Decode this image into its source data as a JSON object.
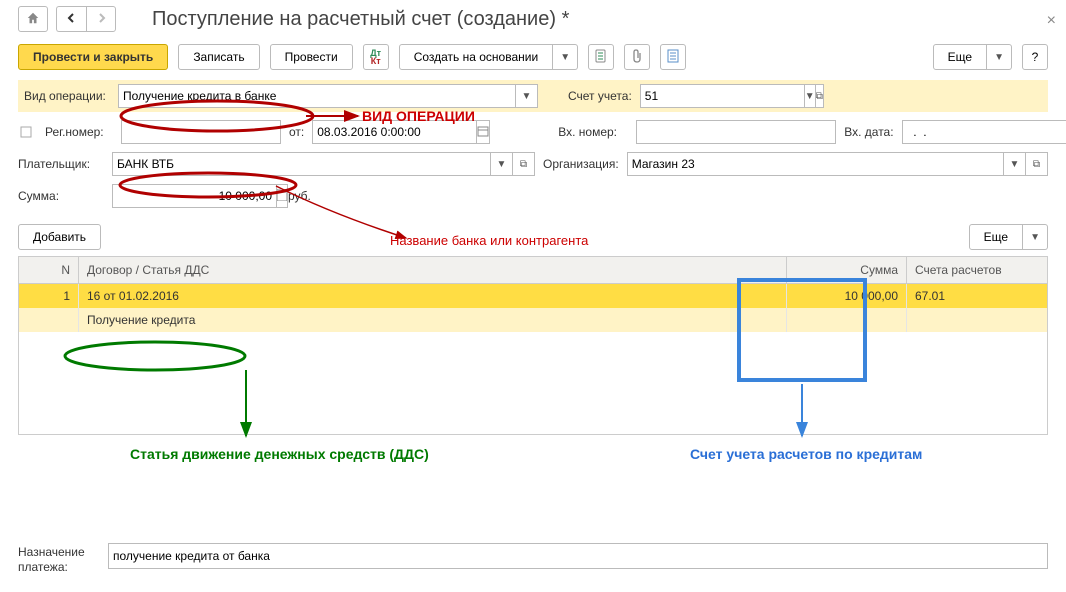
{
  "header": {
    "title": "Поступление на расчетный счет (создание) *"
  },
  "toolbar": {
    "provesti_zakryt": "Провести и закрыть",
    "zapisat": "Записать",
    "provesti": "Провести",
    "sozdat_osnov": "Создать на основании",
    "eshe": "Еще",
    "help": "?"
  },
  "form": {
    "vid_operacii_label": "Вид операции:",
    "vid_operacii_value": "Получение кредита в банке",
    "schet_ucheta_label": "Счет учета:",
    "schet_ucheta_value": "51",
    "reg_nomer_label": "Рег.номер:",
    "reg_nomer_value": "",
    "ot_label": "от:",
    "ot_value": "08.03.2016 0:00:00",
    "vh_nomer_label": "Вх. номер:",
    "vh_nomer_value": "",
    "vh_data_label": "Вх. дата:",
    "vh_data_value": "  .  .",
    "platelshik_label": "Плательщик:",
    "platelshik_value": "БАНК ВТБ",
    "organizacia_label": "Организация:",
    "organizacia_value": "Магазин 23",
    "summa_label": "Сумма:",
    "summa_value": "10 000,00",
    "summa_unit": "руб.",
    "dobavit": "Добавить",
    "eshe": "Еще"
  },
  "grid": {
    "headers": {
      "n": "N",
      "dogovor": "Договор / Статья ДДС",
      "summa": "Сумма",
      "scheta": "Счета расчетов"
    },
    "rows": [
      {
        "n": "1",
        "dogovor_line1": "16 от 01.02.2016",
        "dogovor_line2": "Получение кредита",
        "summa": "10 000,00",
        "scheta": "67.01"
      }
    ]
  },
  "bottom": {
    "naznach_label": "Назначение платежа:",
    "naznach_value": "получение кредита от банка"
  },
  "annotations": {
    "vid_op": "ВИД ОПЕРАЦИИ",
    "bank_name": "Название банка или контрагента",
    "dds": "Статья движение денежных средств (ДДС)",
    "acct": "Счет учета расчетов по кредитам"
  }
}
